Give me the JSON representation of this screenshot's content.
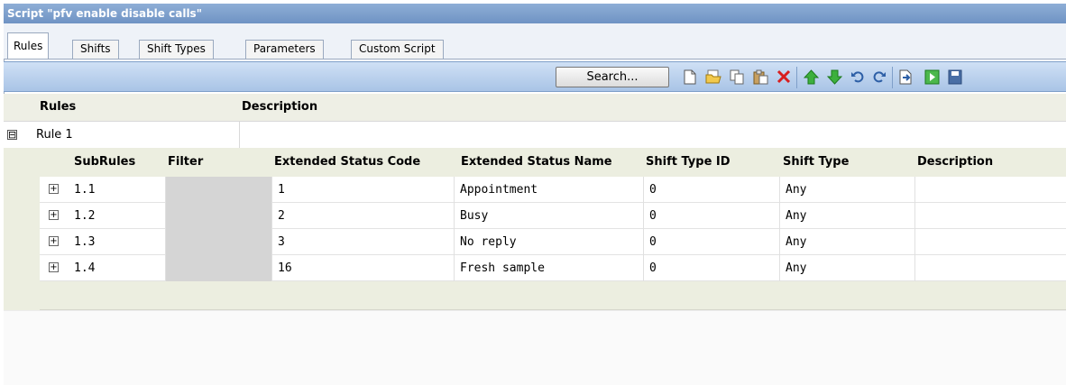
{
  "window": {
    "title": "Script \"pfv enable disable calls\""
  },
  "tabs": [
    {
      "label": "Rules",
      "active": true
    },
    {
      "label": "Shifts",
      "active": false
    },
    {
      "label": "Shift Types",
      "active": false
    },
    {
      "label": "Parameters",
      "active": false
    },
    {
      "label": "Custom Script",
      "active": false
    }
  ],
  "toolbar": {
    "search_label": "Search...",
    "icons": [
      "new-icon",
      "open-folder-icon",
      "copy-icon",
      "paste-icon",
      "delete-icon",
      "move-up-icon",
      "move-down-icon",
      "undo-icon",
      "redo-icon",
      "export-icon",
      "run-icon",
      "save-icon"
    ]
  },
  "grid": {
    "headers": {
      "rules": "Rules",
      "description": "Description"
    },
    "rule": {
      "name": "Rule 1",
      "expander": "⊟"
    },
    "sub_headers": {
      "subrules": "SubRules",
      "filter": "Filter",
      "ext_status_code": "Extended Status Code",
      "ext_status_name": "Extended Status Name",
      "shift_type_id": "Shift Type ID",
      "shift_type": "Shift Type",
      "description": "Description"
    },
    "subrules": [
      {
        "id": "1.1",
        "filter": "",
        "code": "1",
        "name": "Appointment",
        "shift_type_id": "0",
        "shift_type": "Any",
        "description": ""
      },
      {
        "id": "1.2",
        "filter": "",
        "code": "2",
        "name": "Busy",
        "shift_type_id": "0",
        "shift_type": "Any",
        "description": ""
      },
      {
        "id": "1.3",
        "filter": "",
        "code": "3",
        "name": "No reply",
        "shift_type_id": "0",
        "shift_type": "Any",
        "description": ""
      },
      {
        "id": "1.4",
        "filter": "",
        "code": "16",
        "name": "Fresh sample",
        "shift_type_id": "0",
        "shift_type": "Any",
        "description": ""
      }
    ]
  },
  "colors": {
    "titlebar": "#7f9fcc",
    "toolbar": "#b9d0ed",
    "delete_red": "#d81e1e",
    "arrow_green": "#3db03d"
  }
}
